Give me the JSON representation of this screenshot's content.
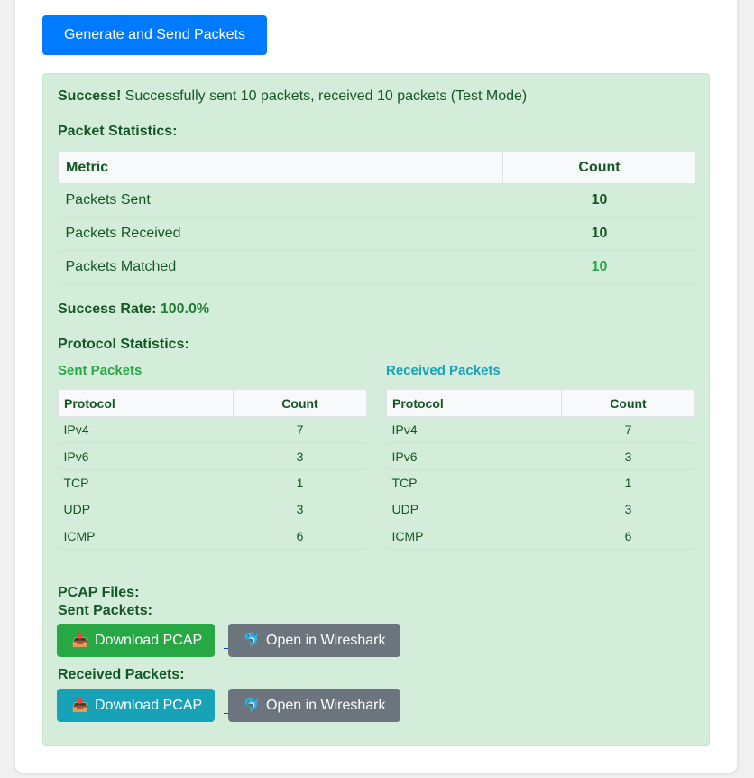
{
  "generate_button": "Generate and Send Packets",
  "result": {
    "strong": "Success!",
    "message": " Successfully sent 10 packets, received 10 packets (Test Mode)"
  },
  "packet_stats": {
    "heading": "Packet Statistics:",
    "headers": {
      "metric": "Metric",
      "count": "Count"
    },
    "rows": [
      {
        "metric": "Packets Sent",
        "count": "10"
      },
      {
        "metric": "Packets Received",
        "count": "10"
      },
      {
        "metric": "Packets Matched",
        "count": "10"
      }
    ]
  },
  "success_rate": {
    "label": "Success Rate: ",
    "value": "100.0%"
  },
  "protocol_stats": {
    "heading": "Protocol Statistics:",
    "sent": {
      "title": "Sent Packets",
      "headers": {
        "protocol": "Protocol",
        "count": "Count"
      },
      "rows": [
        {
          "protocol": "IPv4",
          "count": "7"
        },
        {
          "protocol": "IPv6",
          "count": "3"
        },
        {
          "protocol": "TCP",
          "count": "1"
        },
        {
          "protocol": "UDP",
          "count": "3"
        },
        {
          "protocol": "ICMP",
          "count": "6"
        }
      ]
    },
    "received": {
      "title": "Received Packets",
      "headers": {
        "protocol": "Protocol",
        "count": "Count"
      },
      "rows": [
        {
          "protocol": "IPv4",
          "count": "7"
        },
        {
          "protocol": "IPv6",
          "count": "3"
        },
        {
          "protocol": "TCP",
          "count": "1"
        },
        {
          "protocol": "UDP",
          "count": "3"
        },
        {
          "protocol": "ICMP",
          "count": "6"
        }
      ]
    }
  },
  "pcap": {
    "heading": "PCAP Files:",
    "sent_label": "Sent Packets:",
    "received_label": "Received Packets:",
    "download_label": "Download PCAP",
    "wireshark_label": "Open in Wireshark",
    "download_icon": "inbox-tray-icon",
    "wireshark_icon": "dolphin-icon"
  },
  "colors": {
    "primary": "#007bff",
    "success_bg": "#d4edda",
    "success_text": "#155724",
    "green": "#28a745",
    "teal": "#17a2b8",
    "gray": "#6c757d"
  }
}
